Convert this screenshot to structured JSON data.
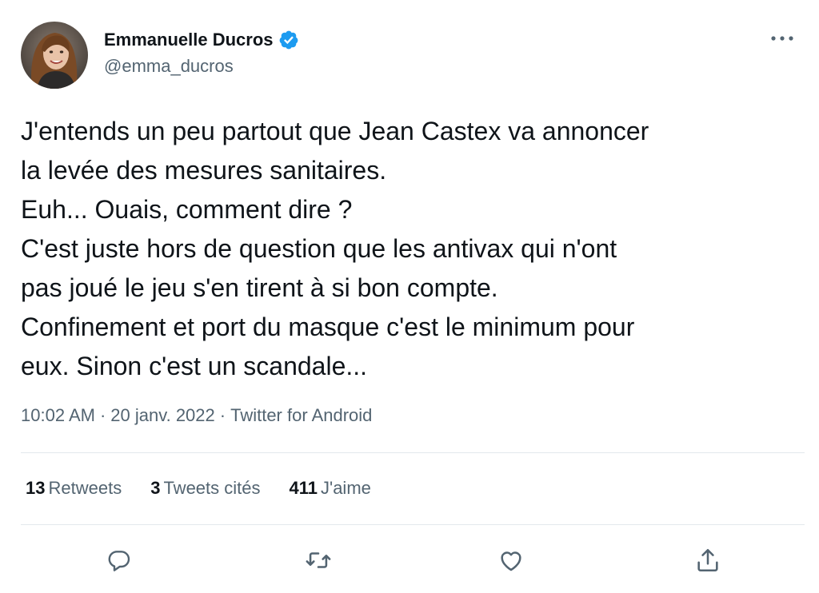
{
  "author": {
    "display_name": "Emmanuelle Ducros",
    "handle": "@emma_ducros",
    "verified": true,
    "verified_color": "#1d9bf0"
  },
  "tweet": {
    "text": "J'entends un peu partout que Jean Castex va annoncer\nla levée des mesures sanitaires.\nEuh... Ouais, comment dire ?\nC'est juste hors de question que les antivax qui n'ont\npas joué le jeu s'en tirent à si bon compte.\nConfinement et port du masque c'est le minimum pour\neux. Sinon c'est un scandale...",
    "time": "10:02 AM",
    "date": "20 janv. 2022",
    "separator": "·",
    "source": "Twitter for Android"
  },
  "stats": {
    "retweets_count": "13",
    "retweets_label": "Retweets",
    "quotes_count": "3",
    "quotes_label": "Tweets cités",
    "likes_count": "411",
    "likes_label": "J'aime"
  },
  "actions": {
    "icons": [
      "reply-icon",
      "retweet-icon",
      "like-icon",
      "share-icon"
    ],
    "icon_color": "#536471"
  },
  "more_icon": "more-icon"
}
